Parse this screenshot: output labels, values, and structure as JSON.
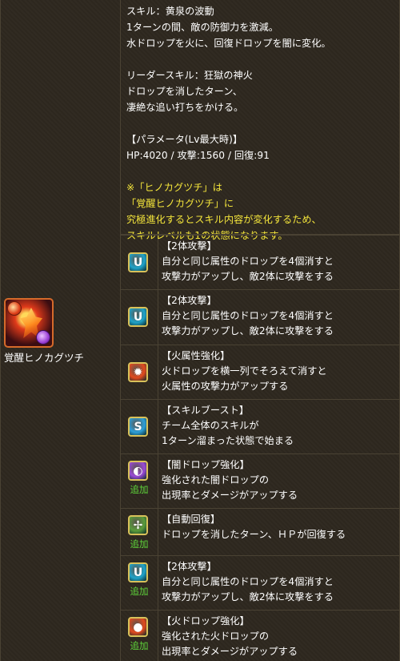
{
  "skill": {
    "active_name_line": "スキル：黄泉の波動",
    "active_desc": [
      "1ターンの間、敵の防御力を激減。",
      "水ドロップを火に、回復ドロップを闇に変化。"
    ],
    "leader_name_line": "リーダースキル：狂獄の神火",
    "leader_desc": [
      "ドロップを消したターン、",
      "凄絶な追い打ちをかける。"
    ],
    "param_heading": "【パラメータ(Lv最大時)】",
    "param_values": "HP:4020 / 攻撃:1560 / 回復:91",
    "note": [
      "※「ヒノカグツチ」は",
      "「覚醒ヒノカグツチ」に",
      "究極進化するとスキル内容が変化するため、",
      "スキルレベルも1の状態になります。"
    ]
  },
  "character": {
    "name": "覚醒ヒノカグツチ",
    "icon": "hinokagutsuchi-portrait-icon"
  },
  "awakenings": [
    {
      "icon": "two-pronged-attack-icon",
      "color": "#1fa3c9",
      "glyph": "U",
      "tag": "",
      "title": "【2体攻撃】",
      "lines": [
        "自分と同じ属性のドロップを4個消すと",
        "攻撃力がアップし、敵2体に攻撃をする"
      ]
    },
    {
      "icon": "two-pronged-attack-icon",
      "color": "#1fa3c9",
      "glyph": "U",
      "tag": "",
      "title": "【2体攻撃】",
      "lines": [
        "自分と同じ属性のドロップを4個消すと",
        "攻撃力がアップし、敵2体に攻撃をする"
      ]
    },
    {
      "icon": "fire-row-enhance-icon",
      "color": "#e24a1e",
      "glyph": "✹",
      "tag": "",
      "title": "【火属性強化】",
      "lines": [
        "火ドロップを横一列でそろえて消すと",
        "火属性の攻撃力がアップする"
      ]
    },
    {
      "icon": "skill-boost-icon",
      "color": "#2d9fd8",
      "glyph": "S",
      "tag": "",
      "title": "【スキルブースト】",
      "lines": [
        "チーム全体のスキルが",
        "1ターン溜まった状態で始まる"
      ]
    },
    {
      "icon": "dark-orb-enhance-icon",
      "color": "#9b4ad6",
      "glyph": "◐",
      "tag": "追加",
      "title": "【闇ドロップ強化】",
      "lines": [
        "強化された闇ドロップの",
        "出現率とダメージがアップする"
      ]
    },
    {
      "icon": "auto-recover-icon",
      "color": "#5a9c3a",
      "glyph": "✢",
      "tag": "追加",
      "title": "【自動回復】",
      "lines": [
        "ドロップを消したターン、ＨＰが回復する"
      ]
    },
    {
      "icon": "two-pronged-attack-icon",
      "color": "#1fa3c9",
      "glyph": "U",
      "tag": "追加",
      "title": "【2体攻撃】",
      "lines": [
        "自分と同じ属性のドロップを4個消すと",
        "攻撃力がアップし、敵2体に攻撃をする"
      ]
    },
    {
      "icon": "fire-orb-enhance-icon",
      "color": "#e24a1e",
      "glyph": "●",
      "tag": "追加",
      "title": "【火ドロップ強化】",
      "lines": [
        "強化された火ドロップの",
        "出現率とダメージがアップする"
      ]
    }
  ]
}
